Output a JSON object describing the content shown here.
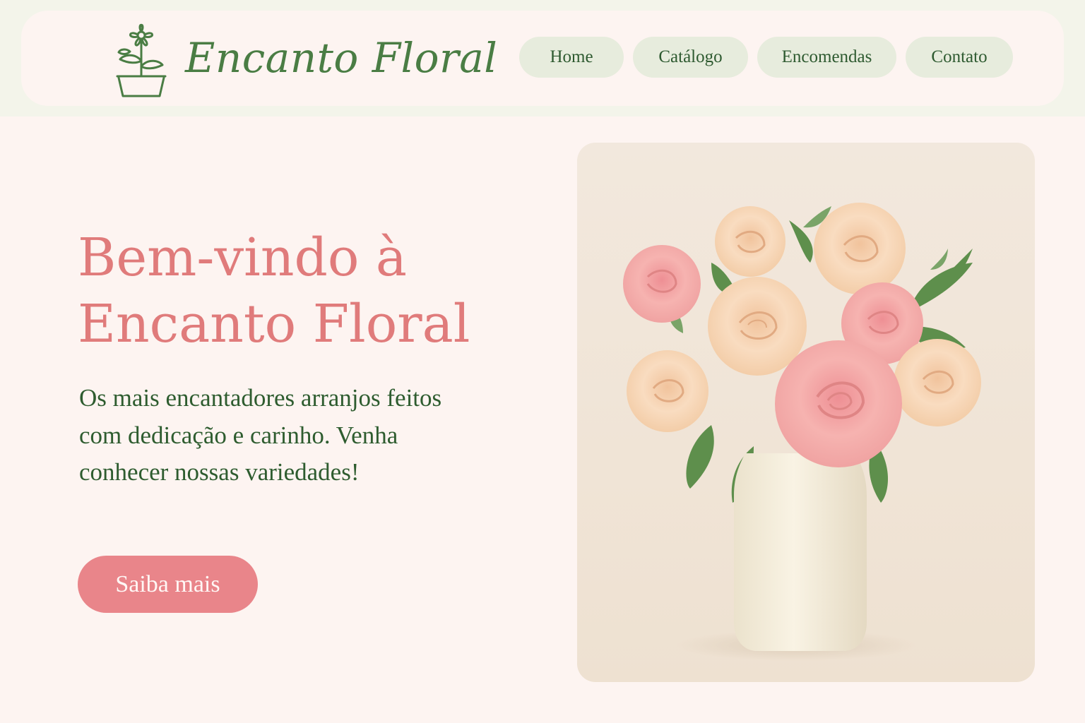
{
  "brand": {
    "name": "Encanto Floral",
    "logo_icon": "flower-pot-icon",
    "colors": {
      "green": "#4a7d44",
      "pink": "#e07b7b",
      "button": "#e9858a",
      "nav_bg": "#e7ecdd"
    }
  },
  "nav": {
    "items": [
      {
        "label": "Home"
      },
      {
        "label": "Catálogo"
      },
      {
        "label": "Encomendas"
      },
      {
        "label": "Contato"
      }
    ]
  },
  "hero": {
    "title_line1": "Bem-vindo à",
    "title_line2": "Encanto Floral",
    "description": "Os mais encantadores arranjos feitos com dedicação e carinho. Venha conhecer nossas variedades!",
    "cta_label": "Saiba mais",
    "image": "rose-bouquet-vase-image"
  }
}
